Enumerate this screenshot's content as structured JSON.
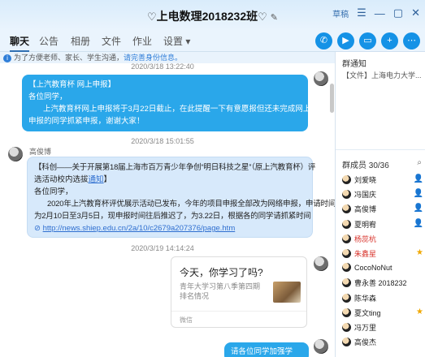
{
  "window": {
    "title": "上电数理2018232班",
    "mode_label": "草稿",
    "controls": [
      "☰",
      "—",
      "▢",
      "✕"
    ]
  },
  "tabs": [
    "聊天",
    "公告",
    "相册",
    "文件",
    "作业",
    "设置"
  ],
  "notice": {
    "text": "为了方便老师、家长、学生沟通，",
    "link": "请完善身份信息。"
  },
  "chat": {
    "timestamps": [
      "2020/3/18 13:22:40",
      "2020/3/18 15:01:55",
      "2020/3/19 14:14:24"
    ],
    "msg1": {
      "line1": "【上汽教育杯 网上申报】",
      "line2": "各位同学，",
      "line3": "上汽教育杯网上申报将于3月22日截止，在此提醒一下有意愿报但还未完成网上系统",
      "line4": "申报的同学抓紧申报，谢谢大家！"
    },
    "msg2": {
      "sender": "高俊博",
      "line1": "【科创——关于开展第18届上海市百万青少年争创“明日科技之星”（原上汽教育杯）评",
      "line2_pre": "选活动校内选拔",
      "line2_link": "通知",
      "line2_post": "】",
      "line3": "各位同学，",
      "line4": "2020年上汽教育杯评优展示活动已发布，今年的项目申报全部改为网络申报，申请时间",
      "line5": "为2月10日至3月5日，现申报时间往后推迟了，为3.22日，根据各的同学请抓紧时间",
      "url": "http://news.shiep.edu.cn/2a/10/c2679a207376/page.htm"
    },
    "card": {
      "title": "今天，你学习了吗?",
      "desc": "青年大学习第八季第四期排名情况",
      "source": "微信"
    },
    "msg4": "请各位同学加强学习!"
  },
  "side": {
    "announce_title": "群通知",
    "announce_text": "【文件】上海电力大学...",
    "members_title": "群成员 30/36",
    "members": [
      {
        "name": "刘爱晓",
        "red": false,
        "badge": "👤"
      },
      {
        "name": "冯国庆",
        "red": false,
        "badge": "👤"
      },
      {
        "name": "高俊博",
        "red": false,
        "badge": "👤"
      },
      {
        "name": "夏明宥",
        "red": false,
        "badge": "👤"
      },
      {
        "name": "杨蕊杭",
        "red": true,
        "badge": ""
      },
      {
        "name": "朱鑫星",
        "red": true,
        "badge": "★"
      },
      {
        "name": "CocoNoNut",
        "red": false,
        "badge": ""
      },
      {
        "name": "曹永善 2018232",
        "red": false,
        "badge": ""
      },
      {
        "name": "陈华森",
        "red": false,
        "badge": ""
      },
      {
        "name": "夏文ting",
        "red": false,
        "badge": "★"
      },
      {
        "name": "冯万里",
        "red": false,
        "badge": ""
      },
      {
        "name": "高俊杰",
        "red": false,
        "badge": ""
      }
    ]
  }
}
